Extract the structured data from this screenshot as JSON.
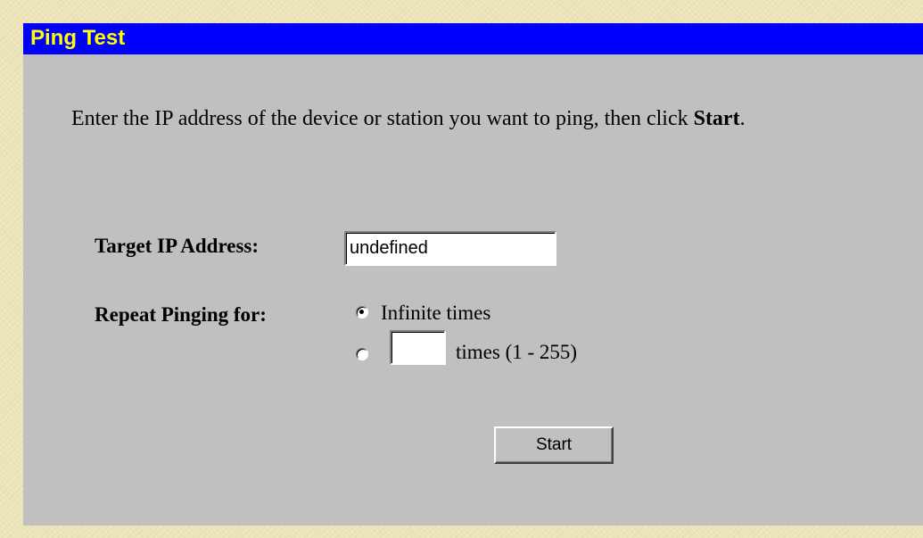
{
  "page": {
    "title": "Ping Test",
    "instructions_prefix": "Enter the IP address of the device or station you want to ping, then click ",
    "instructions_bold": "Start",
    "instructions_suffix": "."
  },
  "form": {
    "target_ip_label": "Target IP Address:",
    "target_ip_value": "undefined",
    "repeat_label": "Repeat Pinging for:",
    "options": [
      {
        "label": "Infinite times",
        "selected": true
      },
      {
        "label": "times (1 - 255)",
        "selected": false,
        "value": ""
      }
    ],
    "start_button": "Start"
  },
  "colors": {
    "title_bar": "#0000ff",
    "title_text": "#ffff00",
    "panel": "#c0c0c0",
    "background": "#ece4b8"
  }
}
